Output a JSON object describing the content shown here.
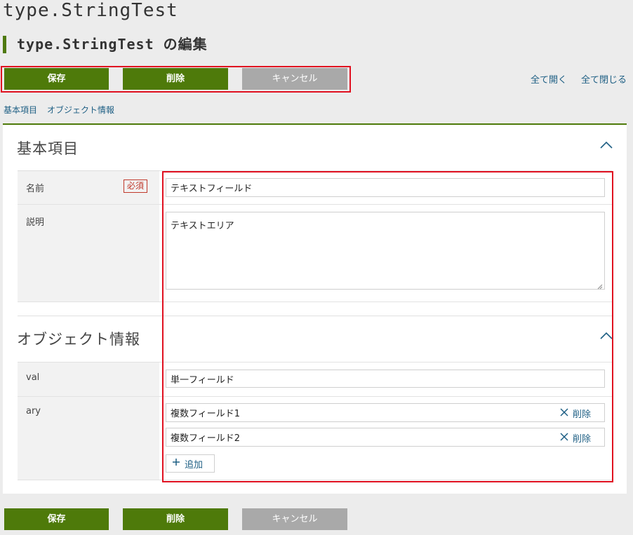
{
  "app": {
    "title": "type.StringTest"
  },
  "page": {
    "heading": "type.StringTest の編集"
  },
  "toolbar": {
    "save_label": "保存",
    "delete_label": "削除",
    "cancel_label": "キャンセル",
    "expand_all_label": "全て開く",
    "collapse_all_label": "全て閉じる"
  },
  "anchors": {
    "basic_label": "基本項目",
    "object_label": "オブジェクト情報"
  },
  "basic": {
    "title": "基本項目",
    "name_label": "名前",
    "required_badge": "必須",
    "name_value": "テキストフィールド",
    "desc_label": "説明",
    "desc_value": "テキストエリア"
  },
  "object": {
    "title": "オブジェクト情報",
    "val_label": "val",
    "val_value": "単一フィールド",
    "ary_label": "ary",
    "ary_items": [
      {
        "value": "複数フィールド1",
        "delete_label": "削除"
      },
      {
        "value": "複数フィールド2",
        "delete_label": "削除"
      }
    ],
    "add_label": "追加"
  },
  "bottom_toolbar": {
    "save_label": "保存",
    "delete_label": "削除",
    "cancel_label": "キャンセル"
  },
  "colors": {
    "accent": "#4e7a0a",
    "disabled": "#a9a9a9",
    "link": "#1e5f84",
    "highlight": "#e01020"
  }
}
